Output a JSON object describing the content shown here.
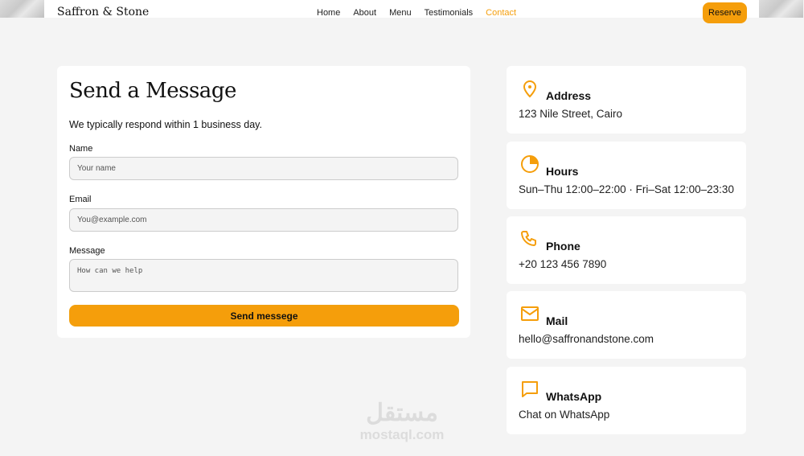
{
  "header": {
    "logo": "Saffron & Stone",
    "nav": [
      {
        "label": "Home"
      },
      {
        "label": "About"
      },
      {
        "label": "Menu"
      },
      {
        "label": "Testimonials"
      },
      {
        "label": "Contact",
        "active": true
      }
    ],
    "reserve_label": "Reserve"
  },
  "form": {
    "title": "Send a Message",
    "subtitle": "We typically respond within 1 business day.",
    "name_label": "Name",
    "name_placeholder": "Your name",
    "email_label": "Email",
    "email_placeholder": "You@example.com",
    "message_label": "Message",
    "message_placeholder": "How can we help",
    "submit_label": "Send messege"
  },
  "cards": [
    {
      "icon": "map-pin-icon",
      "title": "Address",
      "value": "123 Nile Street, Cairo"
    },
    {
      "icon": "clock-icon",
      "title": "Hours",
      "value": "Sun–Thu 12:00–22:00 · Fri–Sat 12:00–23:30"
    },
    {
      "icon": "phone-icon",
      "title": "Phone",
      "value": "+20 123 456 7890"
    },
    {
      "icon": "mail-icon",
      "title": "Mail",
      "value": "hello@saffronandstone.com"
    },
    {
      "icon": "chat-icon",
      "title": "WhatsApp",
      "value": "Chat on WhatsApp"
    }
  ],
  "watermark": {
    "arabic": "مستقل",
    "latin": "mostaql.com"
  },
  "colors": {
    "accent": "#f59e0b",
    "background": "#f4f4f4"
  }
}
